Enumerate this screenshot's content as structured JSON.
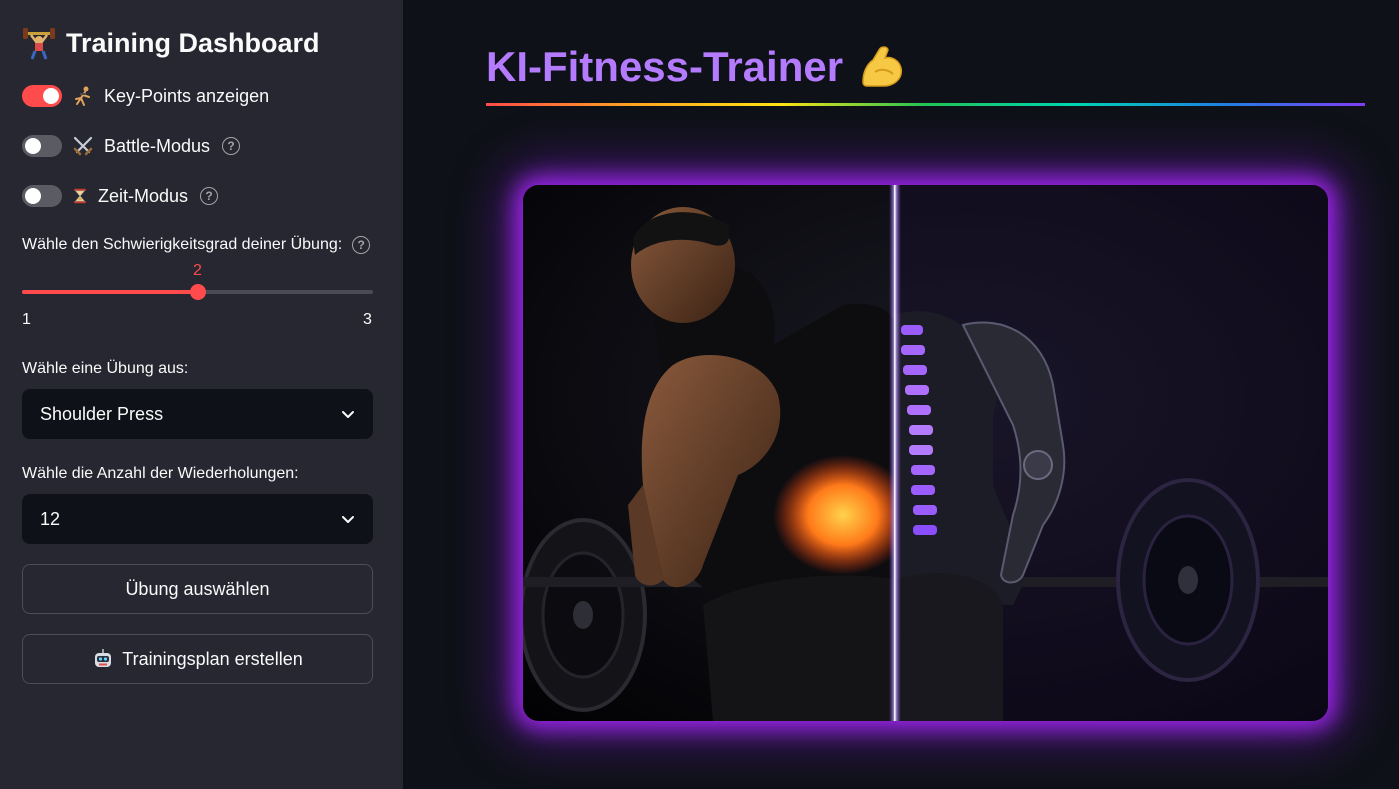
{
  "sidebar": {
    "title": "Training Dashboard",
    "toggles": [
      {
        "label": "Key-Points anzeigen",
        "on": true,
        "icon": "dancer-icon",
        "help": false
      },
      {
        "label": "Battle-Modus",
        "on": false,
        "icon": "crossed-swords-icon",
        "help": true
      },
      {
        "label": "Zeit-Modus",
        "on": false,
        "icon": "hourglass-icon",
        "help": true
      }
    ],
    "difficulty": {
      "label": "Wähle den Schwierigkeitsgrad deiner Übung:",
      "value": "2",
      "min": "1",
      "max": "3",
      "fraction": 0.5
    },
    "exercise": {
      "label": "Wähle eine Übung aus:",
      "selected": "Shoulder Press"
    },
    "repetitions": {
      "label": "Wähle die Anzahl der Wiederholungen:",
      "selected": "12"
    },
    "select_button": "Übung auswählen",
    "plan_button": "Trainingsplan erstellen"
  },
  "main": {
    "title": "KI-Fitness-Trainer",
    "title_icon": "flexed-biceps-icon"
  },
  "colors": {
    "accent": "#ff4b4b",
    "title": "#b57bff",
    "sidebar_bg": "#262730",
    "main_bg": "#0e1117",
    "glow": "#aa28ff"
  }
}
